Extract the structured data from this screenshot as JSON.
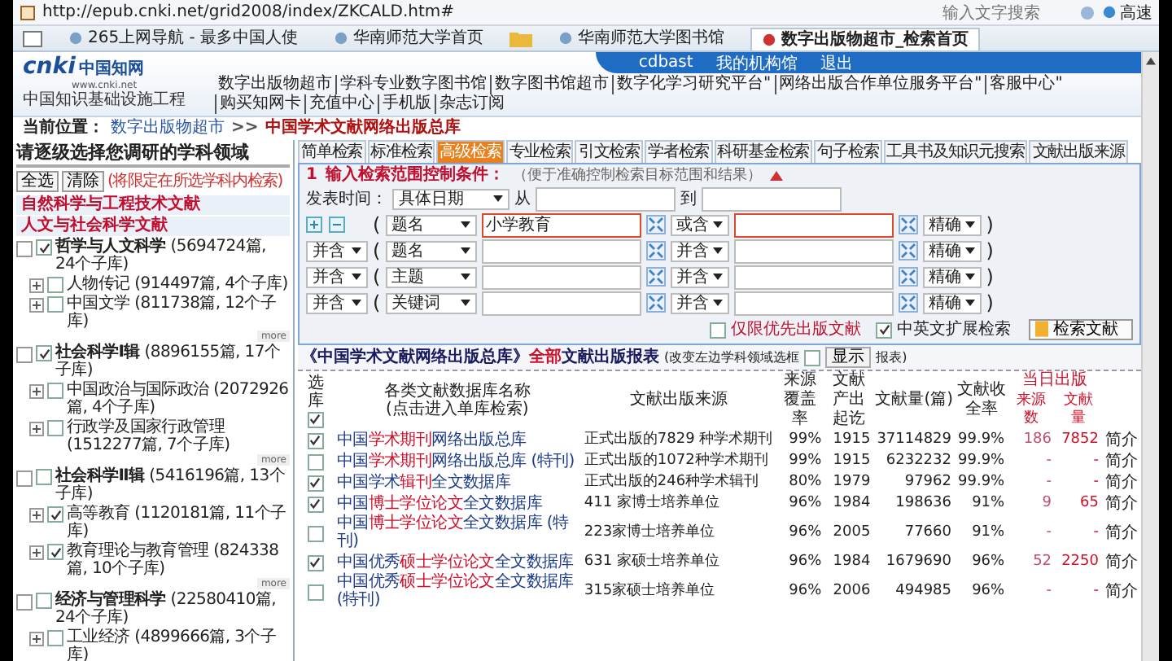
{
  "address_bar": {
    "url": "http://epub.cnki.net/grid2008/index/ZKCALD.htm#",
    "search_placeholder": "输入文字搜索",
    "go_label": "高速"
  },
  "browser_tabs": [
    {
      "kind": "tab",
      "label": "265上网导航 - 最多中国人使",
      "selected": false
    },
    {
      "kind": "tab",
      "label": "华南师范大学首页",
      "selected": false
    },
    {
      "kind": "folder"
    },
    {
      "kind": "tab",
      "label": "华南师范大学图书馆",
      "selected": false
    },
    {
      "kind": "tab",
      "label": "数字出版物超市_检索首页",
      "selected": true
    }
  ],
  "header": {
    "logo_text": "cnki",
    "logo_cn": "中国知网",
    "logo_url": "www.cnki.net",
    "logo_sub": "中国知识基础设施工程",
    "user": "cdbast",
    "links": [
      "我的机构馆",
      "退出"
    ],
    "nav": [
      "数字出版物超市",
      "学科专业数字图书馆",
      "数字图书馆超市",
      "数字化学习研究平台\"",
      "网络出版合作单位服务平台\"",
      "客服中心\"",
      "购买知网卡",
      "充值中心",
      "手机版",
      "杂志订阅"
    ]
  },
  "breadcrumb": {
    "label": "当前位置：",
    "items": [
      {
        "text": "数字出版物超市",
        "current": false
      },
      {
        "text": "中国学术文献网络出版总库",
        "current": true
      }
    ],
    "separator": ">>"
  },
  "left_panel": {
    "title": "请逐级选择您调研的学科领域",
    "buttons": [
      "全选",
      "清除"
    ],
    "note": "(将限定在所选学科内检索)",
    "categories": [
      "自然科学与工程技术文献",
      "人文与社会科学文献"
    ],
    "groups": [
      {
        "name": "哲学与人文科学",
        "count": "(5694724篇, 24个子库)",
        "checked": true,
        "more": "more",
        "children": [
          {
            "name": "人物传记",
            "count": "(914497篇, 4个子库)",
            "checked": false
          },
          {
            "name": "中国文学",
            "count": "(811738篇, 12个子库)",
            "checked": false
          }
        ]
      },
      {
        "name": "社会科学Ⅰ辑",
        "count": "(8896155篇, 17个子库)",
        "checked": true,
        "more": "more",
        "children": [
          {
            "name": "中国政治与国际政治",
            "count": "(2072926篇, 4个子库)",
            "checked": false
          },
          {
            "name": "行政学及国家行政管理",
            "count": "(1512277篇, 7个子库)",
            "checked": false
          }
        ]
      },
      {
        "name": "社会科学Ⅱ辑",
        "count": "(5416196篇, 13个子库)",
        "checked": false,
        "more": "more",
        "children": [
          {
            "name": "高等教育",
            "count": "(1120181篇, 11个子库)",
            "checked": true
          },
          {
            "name": "教育理论与教育管理",
            "count": "(824338篇, 10个子库)",
            "checked": true
          }
        ]
      },
      {
        "name": "经济与管理科学",
        "count": "(22580410篇, 24个子库)",
        "checked": false,
        "children": [
          {
            "name": "工业经济",
            "count": "(4899666篇, 3个子库)",
            "checked": false
          }
        ]
      }
    ]
  },
  "search_tabs": [
    {
      "label": "简单检索",
      "selected": false
    },
    {
      "label": "标准检索",
      "selected": false
    },
    {
      "label": "高级检索",
      "selected": true
    },
    {
      "label": "专业检索",
      "selected": false
    },
    {
      "label": "引文检索",
      "selected": false
    },
    {
      "label": "学者检索",
      "selected": false
    },
    {
      "label": "科研基金检索",
      "selected": false
    },
    {
      "label": "句子检索",
      "selected": false
    },
    {
      "label": "工具书及知识元搜索",
      "selected": false
    },
    {
      "label": "文献出版来源",
      "selected": false
    }
  ],
  "conditions": {
    "index": "1",
    "title": "输入检索范围控制条件：",
    "hint": "（便于准确控制检索目标范围和结果）",
    "paren_open": "(",
    "paren_close": ")",
    "date": {
      "label": "发表时间：",
      "mode": "具体日期",
      "from_label": "从",
      "to_label": "到"
    },
    "rows": [
      {
        "field": "题名",
        "value": "小学教育",
        "op": "或含",
        "precision": "精确",
        "highlighted": true
      },
      {
        "logic": "并含",
        "field": "题名",
        "op": "并含",
        "precision": "精确",
        "highlighted": false
      },
      {
        "logic": "并含",
        "field": "主题",
        "op": "并含",
        "precision": "精确",
        "highlighted": false
      },
      {
        "logic": "并含",
        "field": "关键词",
        "op": "并含",
        "precision": "精确",
        "highlighted": false
      }
    ],
    "options": [
      {
        "label": "仅限优先出版文献",
        "checked": false
      },
      {
        "label": "中英文扩展检索",
        "checked": true
      }
    ],
    "search_button": "检索文献"
  },
  "report": {
    "title_pre": "《中国学术文献网络出版总库》",
    "title_mark": "全部",
    "title_post": "文献出版报表",
    "note_pre": "(改变左边学科领域选框",
    "note_checked": false,
    "show_button": "显示",
    "note_post": "报表)",
    "columns": {
      "select": "选库",
      "select_all": true,
      "name": "各类文献数据库名称",
      "name_sub": "(点击进入单库检索)",
      "source": "文献出版来源",
      "coverage": "来源覆盖率",
      "span": "文献产出起讫",
      "count": "文献量(篇)",
      "rate": "文献收全率",
      "today": "当日出版",
      "today_sources": "来源数",
      "today_count": "文献量"
    },
    "rows": [
      {
        "checked": true,
        "name": [
          {
            "text": "中国",
            "highlight": false
          },
          {
            "text": "学术期刊",
            "highlight": true
          },
          {
            "text": "网络出版总库",
            "highlight": false
          }
        ],
        "source": "正式出版的7829 种学术期刊",
        "coverage": "99%",
        "start": "1915",
        "count": "37114829",
        "rate": "99.9%",
        "today_sources": "186",
        "today_count": "7852",
        "link": "简介"
      },
      {
        "checked": false,
        "name": [
          {
            "text": "中国",
            "highlight": false
          },
          {
            "text": "学术期刊",
            "highlight": true
          },
          {
            "text": "网络出版总库 (特刊)",
            "highlight": false
          }
        ],
        "source": "正式出版的1072种学术期刊",
        "coverage": "99%",
        "start": "1915",
        "count": "6232232",
        "rate": "99.9%",
        "today_sources": "-",
        "today_count": "-",
        "link": "简介"
      },
      {
        "checked": true,
        "name": [
          {
            "text": "中国学术",
            "highlight": false
          },
          {
            "text": "辑刊",
            "highlight": true
          },
          {
            "text": "全文数据库",
            "highlight": false
          }
        ],
        "source": "正式出版的246种学术辑刊",
        "coverage": "80%",
        "start": "1979",
        "count": "97962",
        "rate": "99.9%",
        "today_sources": "-",
        "today_count": "-",
        "link": "简介"
      },
      {
        "checked": true,
        "name": [
          {
            "text": "中国",
            "highlight": false
          },
          {
            "text": "博士学位论文",
            "highlight": true
          },
          {
            "text": "全文数据库",
            "highlight": false
          }
        ],
        "source": "411 家博士培养单位",
        "coverage": "96%",
        "start": "1984",
        "count": "198636",
        "rate": "91%",
        "today_sources": "9",
        "today_count": "65",
        "link": "简介"
      },
      {
        "checked": false,
        "name": [
          {
            "text": "中国",
            "highlight": false
          },
          {
            "text": "博士学位论文",
            "highlight": true
          },
          {
            "text": "全文数据库 (特刊)",
            "highlight": false
          }
        ],
        "source": "223家博士培养单位",
        "coverage": "96%",
        "start": "2005",
        "count": "77660",
        "rate": "91%",
        "today_sources": "-",
        "today_count": "-",
        "link": "简介"
      },
      {
        "checked": true,
        "name": [
          {
            "text": "中国优秀",
            "highlight": false
          },
          {
            "text": "硕士学位论文",
            "highlight": true
          },
          {
            "text": "全文数据库",
            "highlight": false
          }
        ],
        "source": "631 家硕士培养单位",
        "coverage": "96%",
        "start": "1984",
        "count": "1679690",
        "rate": "96%",
        "today_sources": "52",
        "today_count": "2250",
        "link": "简介"
      },
      {
        "checked": false,
        "name": [
          {
            "text": "中国优秀",
            "highlight": false
          },
          {
            "text": "硕士学位论文",
            "highlight": true
          },
          {
            "text": "全文数据库 (特刊)",
            "highlight": false
          }
        ],
        "source": "315家硕士培养单位",
        "coverage": "96%",
        "start": "2006",
        "count": "494985",
        "rate": "96%",
        "today_sources": "-",
        "today_count": "-",
        "link": "简介"
      }
    ]
  }
}
